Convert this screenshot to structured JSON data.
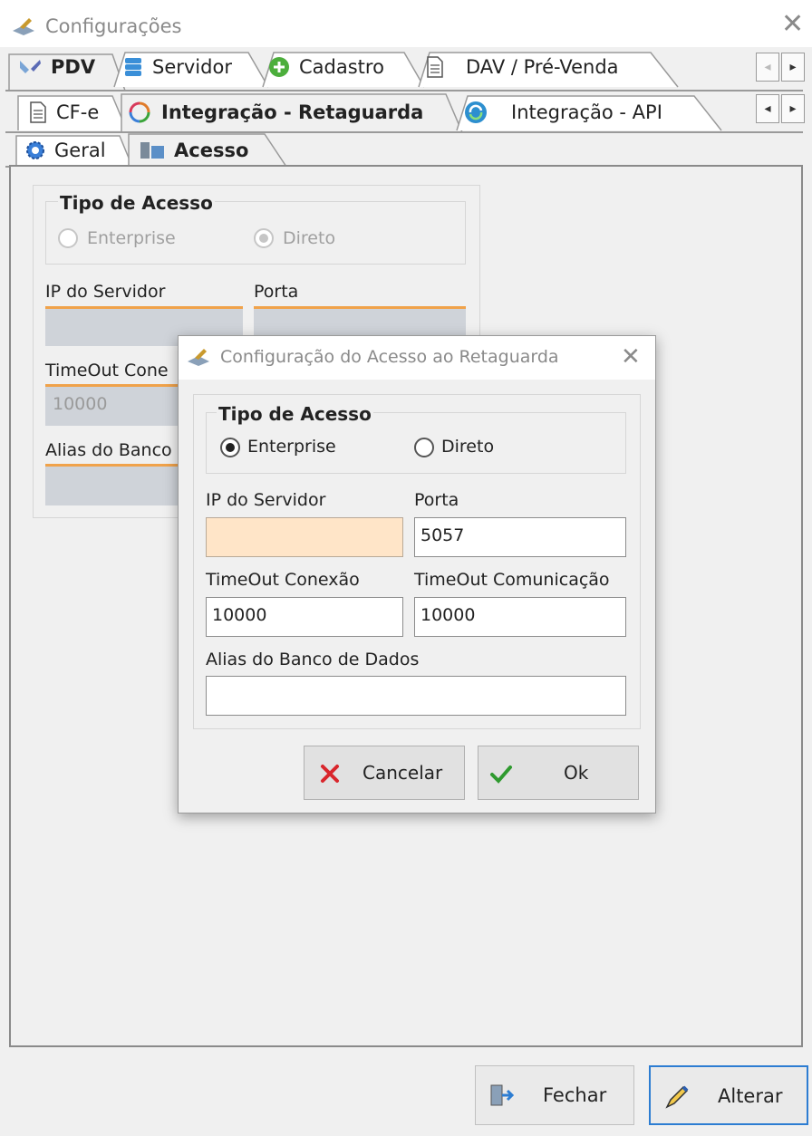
{
  "window": {
    "title": "Configurações",
    "close_glyph": "✕"
  },
  "tabs_level1": [
    {
      "label": "PDV",
      "icon": "tools-icon",
      "active": true
    },
    {
      "label": "Servidor",
      "icon": "database-icon",
      "active": false
    },
    {
      "label": "Cadastro",
      "icon": "add-circle-icon",
      "active": false
    },
    {
      "label": "DAV / Pré-Venda",
      "icon": "document-icon",
      "active": false
    }
  ],
  "tabs_level2": [
    {
      "label": "CF-e",
      "icon": "document-icon",
      "active": false
    },
    {
      "label": "Integração - Retaguarda",
      "icon": "sync-icon",
      "active": true
    },
    {
      "label": "Integração - API",
      "icon": "refresh-icon",
      "active": false
    }
  ],
  "tabs_level3": [
    {
      "label": "Geral",
      "icon": "gear-icon",
      "active": false
    },
    {
      "label": "Acesso",
      "icon": "server-icon",
      "active": true
    }
  ],
  "scroll_glyphs": {
    "left": "◂",
    "right": "▸"
  },
  "background_form": {
    "group_title": "Tipo de Acesso",
    "radio_enterprise": "Enterprise",
    "radio_direto": "Direto",
    "ip_label": "IP do Servidor",
    "porta_label": "Porta",
    "timeout_label": "TimeOut Cone",
    "timeout_value": "10000",
    "alias_label": "Alias do Banco"
  },
  "dialog": {
    "title": "Configuração do Acesso ao Retaguarda",
    "close_glyph": "✕",
    "group_title": "Tipo de Acesso",
    "radio_enterprise": "Enterprise",
    "radio_direto": "Direto",
    "selected": "Enterprise",
    "ip_label": "IP do Servidor",
    "ip_value": "",
    "porta_label": "Porta",
    "porta_value": "5057",
    "timeout_conexao_label": "TimeOut Conexão",
    "timeout_conexao_value": "10000",
    "timeout_comunicacao_label": "TimeOut Comunicação",
    "timeout_comunicacao_value": "10000",
    "alias_label": "Alias do Banco de Dados",
    "alias_value": "",
    "cancel_label": "Cancelar",
    "ok_label": "Ok"
  },
  "footer": {
    "fechar_label": "Fechar",
    "alterar_label": "Alterar"
  },
  "colors": {
    "accent_blue": "#2d7dd2",
    "orange_underline": "#f0a24a",
    "focus_field": "#ffe5c8",
    "cancel_red": "#d9262c",
    "ok_green": "#2f9a2f"
  }
}
